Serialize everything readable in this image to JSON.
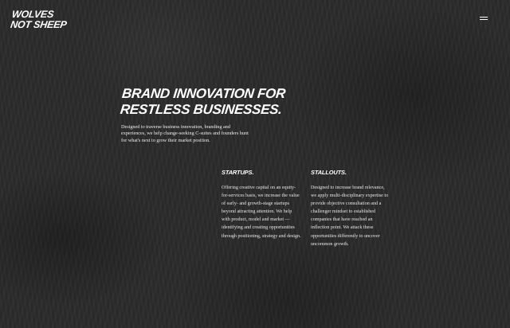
{
  "brand": {
    "logo_line1": "WOLVES",
    "logo_line2": "NOT SHEEP"
  },
  "nav": {
    "menu_icon": "hamburger-menu-icon"
  },
  "hero": {
    "headline_line1": "BRAND INNOVATION FOR",
    "headline_line2": "RESTLESS BUSINESSES.",
    "intro": "Designed to traverse business innovation, branding and experiences, we help change-seeking C-suites and founders hunt for what's next to grow their market position."
  },
  "columns": [
    {
      "title": "STARTUPS.",
      "body": "Offering creative capital on an equity-for-services basis, we increase the value of early- and growth-stage startups beyond attracting attention. We help with product, model and market — identifying and creating opportunities through positioning, strategy and design."
    },
    {
      "title": "STALLOUTS.",
      "body": "Designed to increase brand relevance, we apply multi-disciplinary expertise to provide objective consultation and a challenger mindset to established companies that have reached an inflection point. We attack these opportunities differently to uncover uncommon growth."
    }
  ],
  "colors": {
    "background": "#2b2b2b",
    "text": "#ffffff"
  }
}
